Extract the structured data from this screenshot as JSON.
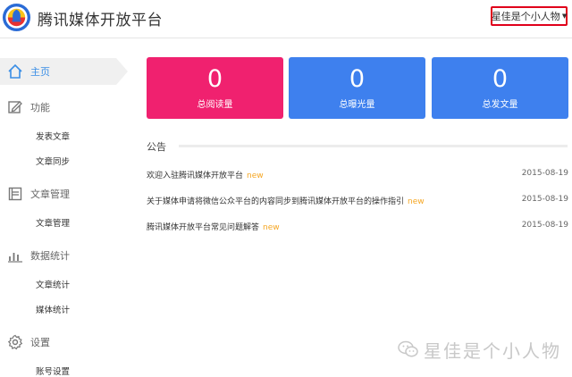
{
  "header": {
    "app_title": "腾讯媒体开放平台",
    "user_name": "星佳是个小人物",
    "caret": "▼"
  },
  "sidebar": {
    "items": [
      {
        "label": "主页",
        "icon": "home-icon",
        "subitems": []
      },
      {
        "label": "功能",
        "icon": "edit-icon",
        "subitems": [
          "发表文章",
          "文章同步"
        ]
      },
      {
        "label": "文章管理",
        "icon": "document-icon",
        "subitems": [
          "文章管理"
        ]
      },
      {
        "label": "数据统计",
        "icon": "bar-chart-icon",
        "subitems": [
          "文章统计",
          "媒体统计"
        ]
      },
      {
        "label": "设置",
        "icon": "gear-icon",
        "subitems": [
          "账号设置"
        ]
      }
    ]
  },
  "stats": [
    {
      "value": "0",
      "label": "总阅读量",
      "color": "#f0216f"
    },
    {
      "value": "0",
      "label": "总曝光量",
      "color": "#3e80ee"
    },
    {
      "value": "0",
      "label": "总发文量",
      "color": "#3e80ee"
    }
  ],
  "notices": {
    "title": "公告",
    "items": [
      {
        "text": "欢迎入驻腾讯媒体开放平台",
        "badge": "new",
        "date": "2015-08-19"
      },
      {
        "text": "关于媒体申请将微信公众平台的内容同步到腾讯媒体开放平台的操作指引",
        "badge": "new",
        "date": "2015-08-19"
      },
      {
        "text": "腾讯媒体开放平台常见问题解答",
        "badge": "new",
        "date": "2015-08-19"
      }
    ]
  },
  "watermark": {
    "text": "星佳是个小人物",
    "icon": "wechat-icon"
  },
  "colors": {
    "accent": "#3a8ee6",
    "highlight_border": "#e0001b",
    "new_badge": "#f5a623"
  }
}
